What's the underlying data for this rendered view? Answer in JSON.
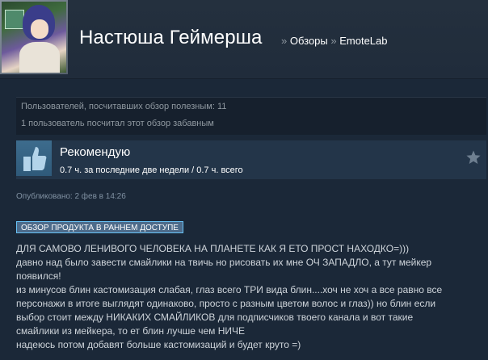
{
  "header": {
    "profile_name": "Настюша Геймерша",
    "separator": "»",
    "crumb_reviews": "Обзоры",
    "crumb_game": "EmoteLab"
  },
  "ratings": {
    "helpful": "Пользователей, посчитавших обзор полезным: 11",
    "funny": "1 пользователь посчитал этот обзор забавным"
  },
  "recommendation": {
    "title": "Рекомендую",
    "hours": "0.7 ч. за последние две недели / 0.7 ч. всего",
    "icon": "thumbs-up-icon",
    "award_icon": "star-icon"
  },
  "posted": "Опубликовано: 2 фев в 14:26",
  "early_access_badge": "ОБЗОР ПРОДУКТА В РАННЕМ ДОСТУПЕ",
  "review_lines": [
    "ДЛЯ САМОВО ЛЕНИВОГО ЧЕЛОВЕКА НА ПЛАНЕТЕ КАК Я ЕТО ПРОСТ НАХОДКО=)))",
    "давно над было завести смайлики на твичь но рисовать их мне ОЧ ЗАПАДЛО, а тут мейкер",
    "появился!",
    "из минусов блин кастомизация слабая, глаз всего ТРИ вида блин....хоч не хоч а все равно все",
    "персонажи в итоге выглядят одинаково, просто с разным цветом волос и глаз)) но блин если",
    "выбор стоит между НИКАКИХ СМАЙЛИКОВ для подписчиков твоего канала и вот такие",
    "смайлики из мейкера, то ет блин лучше чем НИЧЕ",
    "надеюсь потом добавят больше кастомизаций и будет круто =)"
  ],
  "colors": {
    "background": "#1b2838",
    "badge_bg": "#4d6b8a",
    "badge_border": "#67c1f5",
    "rec_bg": "#233549"
  }
}
